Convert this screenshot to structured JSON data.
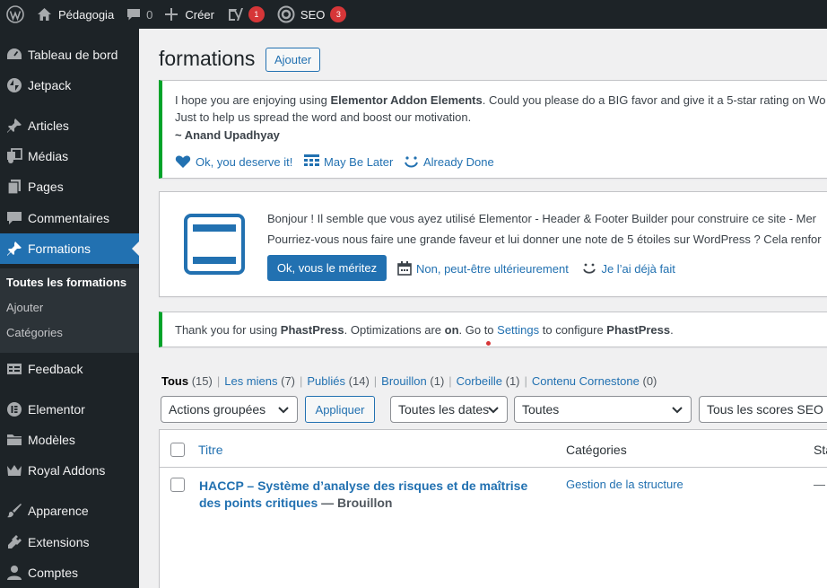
{
  "adminbar": {
    "site_name": "Pédagogia",
    "comments_count": "0",
    "new_label": "Créer",
    "yoast_badge": "1",
    "seo_label": "SEO",
    "seo_badge": "3"
  },
  "sidebar": {
    "items": [
      {
        "label": "Tableau de bord",
        "icon": "dashboard-icon"
      },
      {
        "label": "Jetpack",
        "icon": "jetpack-icon"
      },
      {
        "label": "Articles",
        "icon": "pin-icon"
      },
      {
        "label": "Médias",
        "icon": "media-icon"
      },
      {
        "label": "Pages",
        "icon": "pages-icon"
      },
      {
        "label": "Commentaires",
        "icon": "comment-icon"
      },
      {
        "label": "Formations",
        "icon": "pin-icon"
      },
      {
        "label": "Feedback",
        "icon": "feedback-icon"
      },
      {
        "label": "Elementor",
        "icon": "elementor-icon"
      },
      {
        "label": "Modèles",
        "icon": "folder-icon"
      },
      {
        "label": "Royal Addons",
        "icon": "crown-icon"
      },
      {
        "label": "Apparence",
        "icon": "brush-icon"
      },
      {
        "label": "Extensions",
        "icon": "plugin-icon"
      },
      {
        "label": "Comptes",
        "icon": "user-icon"
      }
    ],
    "submenu": [
      "Toutes les formations",
      "Ajouter",
      "Catégories"
    ]
  },
  "main": {
    "title": "formations",
    "add_button": "Ajouter"
  },
  "notice1": {
    "line1_a": "I hope you are enjoying using ",
    "line1_b": "Elementor Addon Elements",
    "line1_c": ". Could you please do a BIG favor and give it a 5-star rating on Wo",
    "line2": "Just to help us spread the word and boost our motivation.",
    "author": "~ Anand Upadhyay",
    "link_ok": "Ok, you deserve it!",
    "link_later": "May Be Later",
    "link_done": "Already Done"
  },
  "notice2": {
    "line1": "Bonjour ! Il semble que vous ayez utilisé Elementor - Header & Footer Builder pour construire ce site - Mer",
    "line2": "Pourriez-vous nous faire une grande faveur et lui donner une note de 5 étoiles sur WordPress ? Cela renfor",
    "btn_ok": "Ok, vous le méritez",
    "link_later": "Non, peut-être ultérieurement",
    "link_done": "Je l’ai déjà fait",
    "brand_color": "#2271b1"
  },
  "notice3": {
    "t1": "Thank you for using ",
    "t2": "PhastPress",
    "t3": ". Optimizations are ",
    "t4": "on",
    "t5": ". Go to ",
    "t6": "Settings",
    "t7": " to configure ",
    "t8": "PhastPress",
    "t9": "."
  },
  "filters": {
    "all": {
      "label": "Tous",
      "count": "(15)"
    },
    "mine": {
      "label": "Les miens",
      "count": "(7)"
    },
    "published": {
      "label": "Publiés",
      "count": "(14)"
    },
    "draft": {
      "label": "Brouillon",
      "count": "(1)"
    },
    "trash": {
      "label": "Corbeille",
      "count": "(1)"
    },
    "cornerstone": {
      "label": "Contenu Cornestone",
      "count": "(0)"
    }
  },
  "tablenav": {
    "bulk": "Actions groupées",
    "apply": "Appliquer",
    "dates": "Toutes les dates",
    "categories": "Toutes",
    "seo": "Tous les scores SEO"
  },
  "table": {
    "col_title": "Titre",
    "col_categories": "Catégories",
    "col_stat": "Sta",
    "rows": [
      {
        "title": "HACCP – Système d’analyse des risques et de maîtrise des points critiques",
        "state": "— Brouillon",
        "category": "Gestion de la structure",
        "stat": "—"
      }
    ]
  }
}
